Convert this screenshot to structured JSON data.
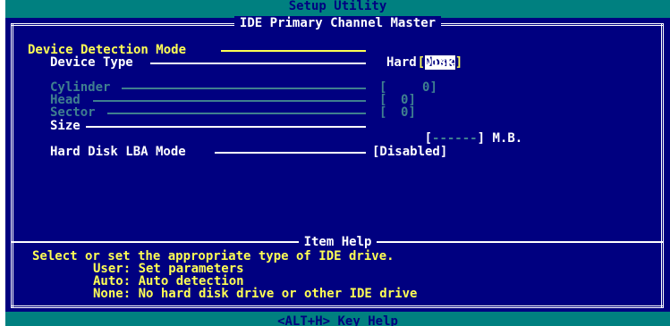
{
  "app_title": "Setup Utility",
  "panel_title": "IDE Primary Channel Master",
  "settings": {
    "detection_mode": {
      "label": "Device Detection Mode",
      "open": "[",
      "value": "None",
      "close": "]"
    },
    "device_type": {
      "label": "Device Type",
      "value": "Hard Disk"
    },
    "cylinder": {
      "label": "Cylinder",
      "open": "[",
      "value": "0",
      "close": "]"
    },
    "head": {
      "label": "Head",
      "open": "[",
      "value": "0",
      "close": "]"
    },
    "sector": {
      "label": "Sector",
      "open": "[",
      "value": "0",
      "close": "]"
    },
    "size": {
      "label": "Size",
      "open": "[",
      "value": "------",
      "close": "]",
      "unit": "M.B."
    },
    "lba_mode": {
      "label": "Hard Disk LBA Mode",
      "value": "[Disabled]"
    }
  },
  "help": {
    "title": "Item Help",
    "lines": [
      "Select or set the appropriate type of IDE drive.",
      "User: Set parameters",
      "Auto: Auto detection",
      "None: No hard disk drive or other IDE drive"
    ]
  },
  "footer": {
    "key_help": "<ALT+H>  Key Help"
  },
  "colors": {
    "background": "#000080",
    "bar": "#008080",
    "highlight": "#ffff54",
    "text": "#ffffff",
    "disabled": "#3f7f8f"
  }
}
